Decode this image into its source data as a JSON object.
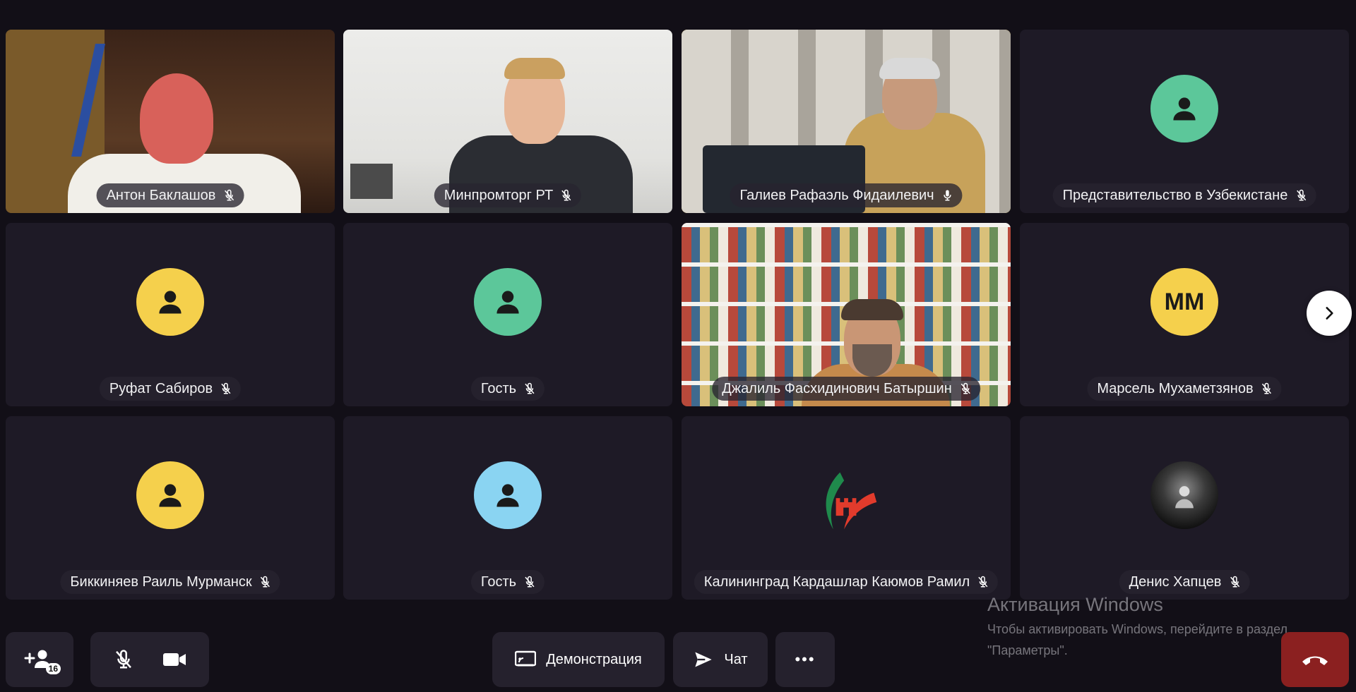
{
  "participants": [
    {
      "name": "Антон Баклашов",
      "type": "video",
      "muted": true
    },
    {
      "name": "Минпромторг РТ",
      "type": "video",
      "muted": true
    },
    {
      "name": "Галиев Рафаэль Фидаилевич",
      "type": "video",
      "muted": false,
      "active_speaker": true
    },
    {
      "name": "Представительство в Узбекистане",
      "type": "avatar",
      "avatar_color": "#5cc79a",
      "muted": true
    },
    {
      "name": "Руфат Сабиров",
      "type": "avatar",
      "avatar_color": "#f5d04c",
      "muted": true
    },
    {
      "name": "Гость",
      "type": "avatar",
      "avatar_color": "#5cc79a",
      "muted": true
    },
    {
      "name": "Джалиль Фасхидинович Батыршин",
      "type": "video",
      "muted": true
    },
    {
      "name": "Марсель Мухаметзянов",
      "type": "avatar",
      "avatar_color": "#f5d04c",
      "initials": "ММ",
      "muted": true
    },
    {
      "name": "Биккиняев Раиль Мурманск",
      "type": "avatar",
      "avatar_color": "#f5d04c",
      "muted": true
    },
    {
      "name": "Гость",
      "type": "avatar",
      "avatar_color": "#8ad4f2",
      "muted": true
    },
    {
      "name": "Калининград Кардашлар Каюмов Рамил",
      "type": "logo",
      "muted": true
    },
    {
      "name": "Денис Хапцев",
      "type": "photo-avatar",
      "muted": true
    }
  ],
  "toolbar": {
    "participants_count": "16",
    "demo_label": "Демонстрация",
    "chat_label": "Чат",
    "more_label": "•••"
  },
  "watermark": {
    "title": "Активация Windows",
    "text": "Чтобы активировать Windows, перейдите в раздел \"Параметры\"."
  },
  "colors": {
    "background": "#120f17",
    "tile": "#1e1a26",
    "active_border": "#f5c518",
    "end_call": "#8b2020"
  }
}
